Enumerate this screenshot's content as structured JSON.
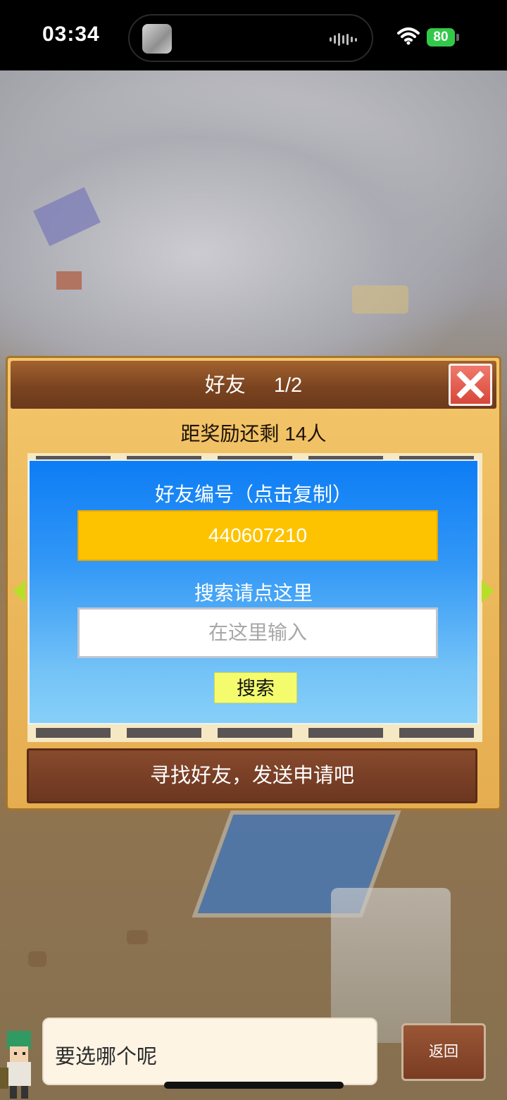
{
  "status_bar": {
    "time": "03:34",
    "battery": "80"
  },
  "dialog": {
    "title": "好友",
    "page": "1/2",
    "reward_text": "距奖励还剩 14人",
    "friend_id_label": "好友编号（点击复制）",
    "friend_id": "440607210",
    "search_label": "搜索请点这里",
    "search_placeholder": "在这里输入",
    "search_button": "搜索",
    "find_button": "寻找好友，发送申请吧"
  },
  "bottom": {
    "speech": "要选哪个呢",
    "back_button": "返回"
  },
  "icons": {
    "close": "close-icon",
    "prev": "arrow-left-icon",
    "next": "arrow-right-icon",
    "wifi": "wifi-icon",
    "battery": "battery-icon"
  },
  "colors": {
    "friend_id_bg": "#fdc300",
    "search_button_bg": "#f4fb6c",
    "panel_blue": "#0d7df5",
    "close_red": "#e0564a"
  }
}
